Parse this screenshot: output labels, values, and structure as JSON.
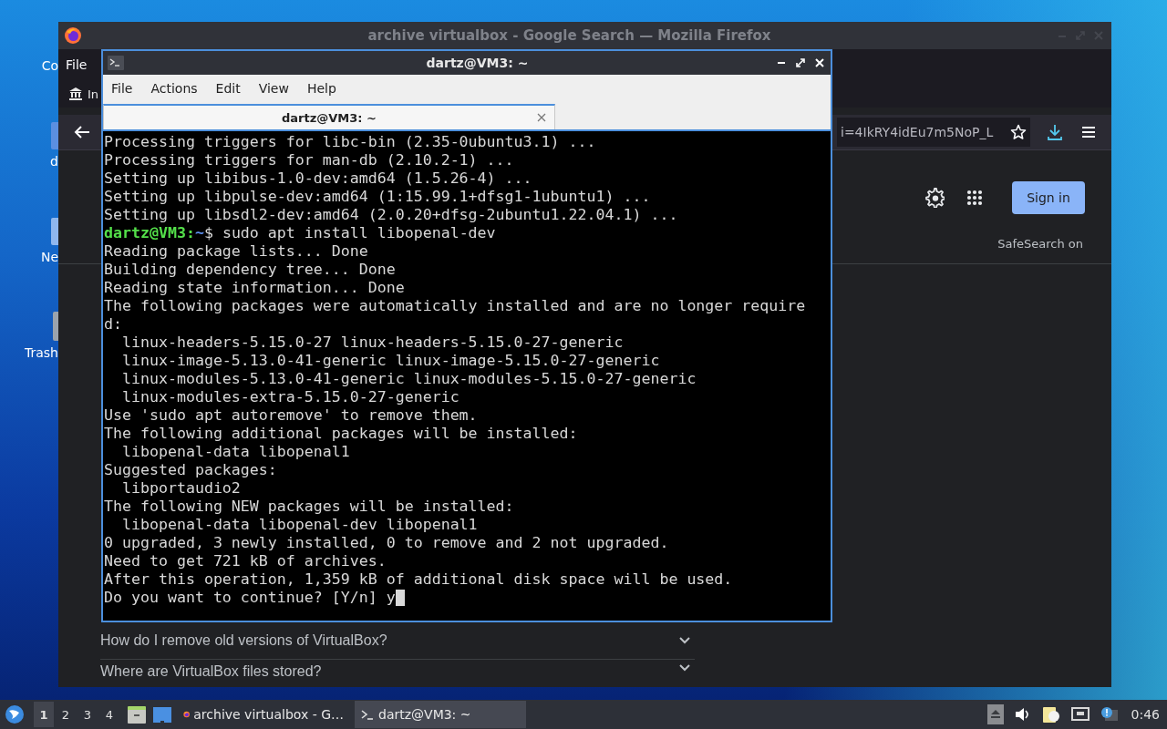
{
  "desktop_icons": [
    {
      "label": "Co"
    },
    {
      "label": "d"
    },
    {
      "label": "Ne"
    },
    {
      "label": "Trash"
    }
  ],
  "firefox": {
    "title": "archive virtualbox - Google Search — Mozilla Firefox",
    "menu": [
      "File"
    ],
    "bookmark": "In",
    "url": "i=4IkRY4idEu7m5NoP_L",
    "sign_in": "Sign in",
    "safesearch": "SafeSearch on",
    "questions": [
      {
        "text": "How do I remove old versions of VirtualBox?",
        "expanded": false
      },
      {
        "text": "Where are VirtualBox files stored?",
        "expanded": false
      }
    ]
  },
  "terminal": {
    "title": "dartz@VM3: ~",
    "menu": [
      "File",
      "Actions",
      "Edit",
      "View",
      "Help"
    ],
    "tabs": [
      {
        "label": "dartz@VM3: ~",
        "selected": true
      }
    ],
    "lines": [
      {
        "kind": "output",
        "text": "Processing triggers for libc-bin (2.35-0ubuntu3.1) ..."
      },
      {
        "kind": "output",
        "text": "Processing triggers for man-db (2.10.2-1) ..."
      },
      {
        "kind": "output",
        "text": "Setting up libibus-1.0-dev:amd64 (1.5.26-4) ..."
      },
      {
        "kind": "output",
        "text": "Setting up libpulse-dev:amd64 (1:15.99.1+dfsg1-1ubuntu1) ..."
      },
      {
        "kind": "output",
        "text": "Setting up libsdl2-dev:amd64 (2.0.20+dfsg-2ubuntu1.22.04.1) ..."
      },
      {
        "kind": "prompt",
        "user": "dartz@VM3:",
        "path": "~",
        "text": "$ sudo apt install libopenal-dev"
      },
      {
        "kind": "output",
        "text": "Reading package lists... Done"
      },
      {
        "kind": "output",
        "text": "Building dependency tree... Done"
      },
      {
        "kind": "output",
        "text": "Reading state information... Done"
      },
      {
        "kind": "output",
        "text": "The following packages were automatically installed and are no longer require"
      },
      {
        "kind": "output",
        "text": "d:"
      },
      {
        "kind": "output",
        "text": "  linux-headers-5.15.0-27 linux-headers-5.15.0-27-generic"
      },
      {
        "kind": "output",
        "text": "  linux-image-5.13.0-41-generic linux-image-5.15.0-27-generic"
      },
      {
        "kind": "output",
        "text": "  linux-modules-5.13.0-41-generic linux-modules-5.15.0-27-generic"
      },
      {
        "kind": "output",
        "text": "  linux-modules-extra-5.15.0-27-generic"
      },
      {
        "kind": "output",
        "text": "Use 'sudo apt autoremove' to remove them."
      },
      {
        "kind": "output",
        "text": "The following additional packages will be installed:"
      },
      {
        "kind": "output",
        "text": "  libopenal-data libopenal1"
      },
      {
        "kind": "output",
        "text": "Suggested packages:"
      },
      {
        "kind": "output",
        "text": "  libportaudio2"
      },
      {
        "kind": "output",
        "text": "The following NEW packages will be installed:"
      },
      {
        "kind": "output",
        "text": "  libopenal-data libopenal-dev libopenal1"
      },
      {
        "kind": "output",
        "text": "0 upgraded, 3 newly installed, 0 to remove and 2 not upgraded."
      },
      {
        "kind": "output",
        "text": "Need to get 721 kB of archives."
      },
      {
        "kind": "output",
        "text": "After this operation, 1,359 kB of additional disk space will be used."
      },
      {
        "kind": "input",
        "text": "Do you want to continue? [Y/n] y",
        "cursor": true
      }
    ]
  },
  "taskbar": {
    "workspaces": [
      {
        "label": "1",
        "selected": true
      },
      {
        "label": "2",
        "selected": false
      },
      {
        "label": "3",
        "selected": false
      },
      {
        "label": "4",
        "selected": false
      }
    ],
    "tasks": [
      {
        "kind": "browser",
        "label": "archive virtualbox - G…",
        "selected": false
      },
      {
        "kind": "terminal",
        "label": "dartz@VM3: ~",
        "selected": true
      }
    ],
    "clock": "0:46"
  }
}
